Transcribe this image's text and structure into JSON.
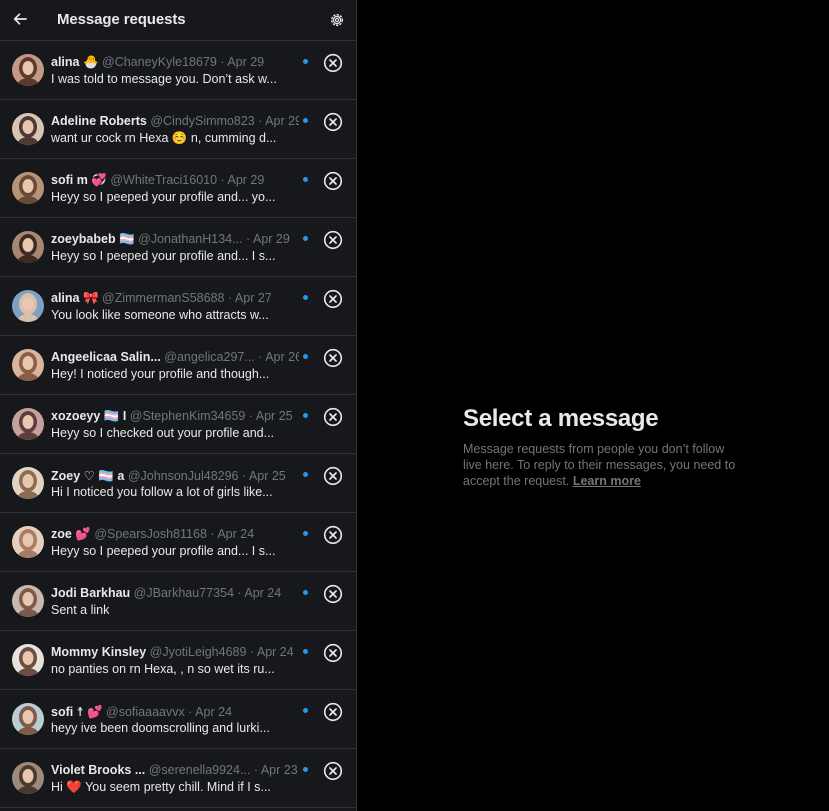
{
  "header": {
    "title": "Message requests",
    "back_icon": "arrow-left-icon",
    "settings_icon": "gear-icon"
  },
  "colors": {
    "panel_bg": "#16181c",
    "page_bg": "#000000",
    "text_primary": "#e7e9ea",
    "text_secondary": "#71767b",
    "accent_blue": "#1d9bf0",
    "divider": "#2f3336"
  },
  "requests": [
    {
      "name": "alina 🐣",
      "handle": "@ChaneyKyle18679",
      "date": "Apr 29",
      "preview": "I was told to message you. Don’t ask w...",
      "unread": true
    },
    {
      "name": "Adeline Roberts",
      "handle": "@CindySimmo823",
      "date": "Apr 29",
      "preview": "want ur cock rn Hexa ☺️ n, cumming d...",
      "unread": true
    },
    {
      "name": "sofi m 💞",
      "handle": "@WhiteTraci16010",
      "date": "Apr 29",
      "preview": "Heyy so I peeped your profile and... yo...",
      "unread": true
    },
    {
      "name": "zoeybabeb 🏳️‍⚧️",
      "handle": "@JonathanH134...",
      "date": "Apr 29",
      "preview": "Heyy so I peeped your profile and... I s...",
      "unread": true
    },
    {
      "name": "alina 🎀",
      "handle": "@ZimmermanS58688",
      "date": "Apr 27",
      "preview": "You look like someone who attracts w...",
      "unread": true
    },
    {
      "name": "Angeelicaa Salin...",
      "handle": "@angelica297...",
      "date": "Apr 26",
      "preview": "Hey! I noticed your profile and though...",
      "unread": true
    },
    {
      "name": "xozoeyy 🏳️‍⚧️ I",
      "handle": "@StephenKim34659",
      "date": "Apr 25",
      "preview": "Heyy so I checked out your profile and...",
      "unread": true
    },
    {
      "name": "Zoey ♡ 🏳️‍⚧️ a",
      "handle": "@JohnsonJul48296",
      "date": "Apr 25",
      "preview": "Hi I noticed you follow a lot of girls like...",
      "unread": true
    },
    {
      "name": "zoe 💕",
      "handle": "@SpearsJosh81168",
      "date": "Apr 24",
      "preview": "Heyy so I peeped your profile and... I s...",
      "unread": true
    },
    {
      "name": "Jodi Barkhau",
      "handle": "@JBarkhau77354",
      "date": "Apr 24",
      "preview": "Sent a link",
      "unread": true
    },
    {
      "name": "Mommy Kinsley",
      "handle": "@JyotiLeigh4689",
      "date": "Apr 24",
      "preview": "no panties on rn Hexa, , n so wet its ru...",
      "unread": true
    },
    {
      "name": "sofi ☨ 💕",
      "handle": "@sofiaaaavvx",
      "date": "Apr 24",
      "preview": "heyy ive been doomscrolling and lurki...",
      "unread": true
    },
    {
      "name": "Violet Brooks ...",
      "handle": "@serenella9924...",
      "date": "Apr 23",
      "preview": "Hi ❤️ You seem pretty chill. Mind if I s...",
      "unread": true
    }
  ],
  "empty_state": {
    "title": "Select a message",
    "body": "Message requests from people you don’t follow live here. To reply to their messages, you need to accept the request.",
    "link": "Learn more"
  }
}
